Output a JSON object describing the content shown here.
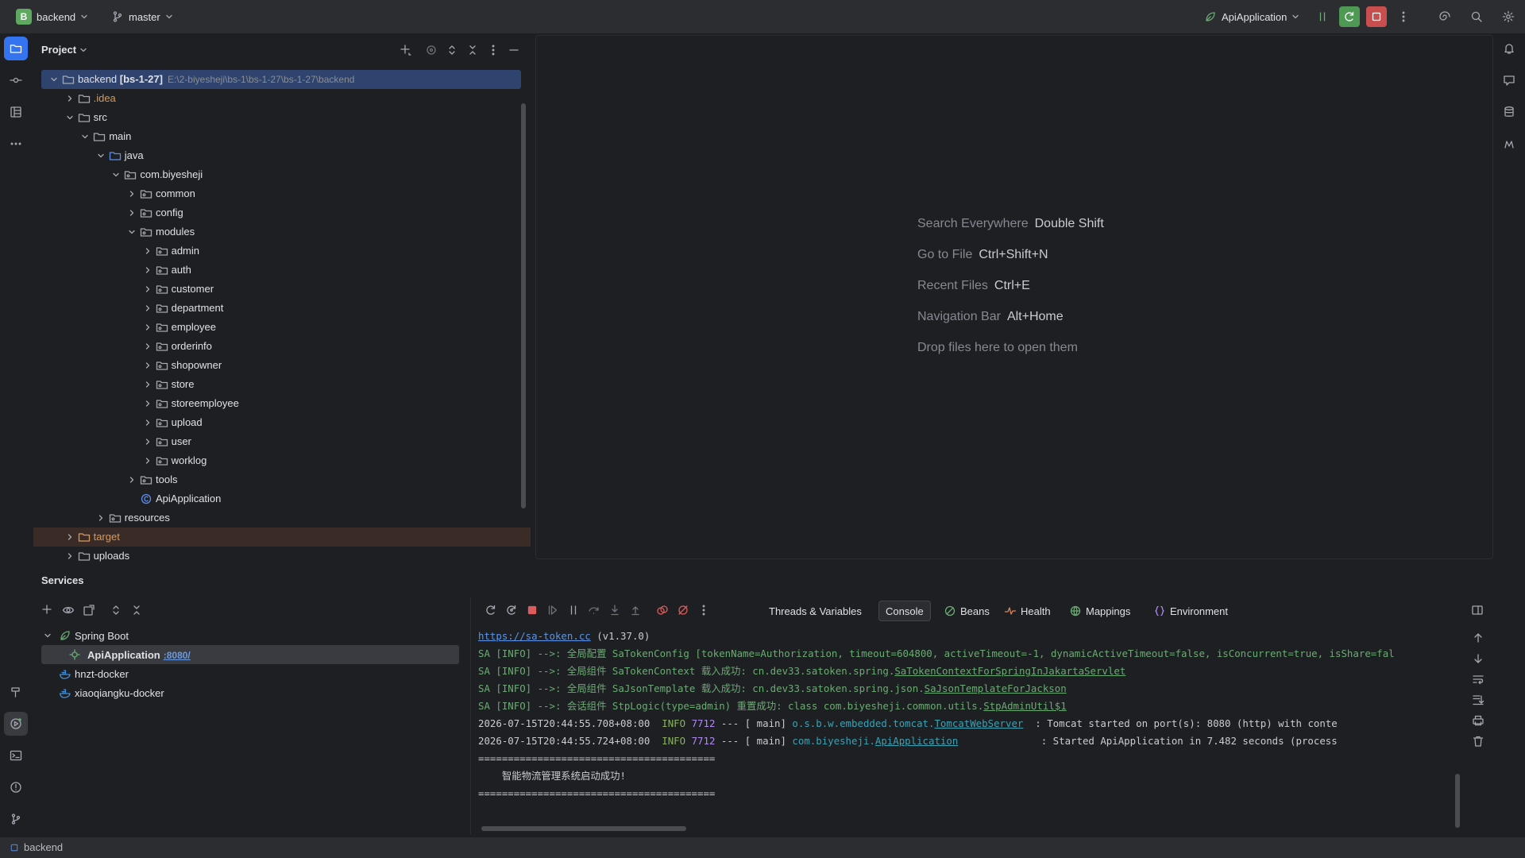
{
  "titlebar": {
    "project_badge": "B",
    "project_name": "backend",
    "branch": "master",
    "run_config": "ApiApplication"
  },
  "project_panel": {
    "title": "Project",
    "tree": [
      {
        "label": "backend",
        "suffix": "[bs-1-27]",
        "path": "E:\\2-biyesheji\\bs-1\\bs-1-27\\bs-1-27\\backend",
        "depth": 0,
        "expanded": true,
        "selected": true
      },
      {
        "label": ".idea",
        "depth": 1,
        "expanded": false,
        "style": "orange"
      },
      {
        "label": "src",
        "depth": 1,
        "expanded": true
      },
      {
        "label": "main",
        "depth": 2,
        "expanded": true
      },
      {
        "label": "java",
        "depth": 3,
        "expanded": true,
        "blue": true
      },
      {
        "label": "com.biyesheji",
        "depth": 4,
        "expanded": true,
        "pkg": true
      },
      {
        "label": "common",
        "depth": 5,
        "expanded": false,
        "pkg": true
      },
      {
        "label": "config",
        "depth": 5,
        "expanded": false,
        "pkg": true
      },
      {
        "label": "modules",
        "depth": 5,
        "expanded": true,
        "pkg": true
      },
      {
        "label": "admin",
        "depth": 6,
        "expanded": false,
        "pkg": true
      },
      {
        "label": "auth",
        "depth": 6,
        "expanded": false,
        "pkg": true
      },
      {
        "label": "customer",
        "depth": 6,
        "expanded": false,
        "pkg": true
      },
      {
        "label": "department",
        "depth": 6,
        "expanded": false,
        "pkg": true
      },
      {
        "label": "employee",
        "depth": 6,
        "expanded": false,
        "pkg": true
      },
      {
        "label": "orderinfo",
        "depth": 6,
        "expanded": false,
        "pkg": true
      },
      {
        "label": "shopowner",
        "depth": 6,
        "expanded": false,
        "pkg": true
      },
      {
        "label": "store",
        "depth": 6,
        "expanded": false,
        "pkg": true
      },
      {
        "label": "storeemployee",
        "depth": 6,
        "expanded": false,
        "pkg": true
      },
      {
        "label": "upload",
        "depth": 6,
        "expanded": false,
        "pkg": true
      },
      {
        "label": "user",
        "depth": 6,
        "expanded": false,
        "pkg": true
      },
      {
        "label": "worklog",
        "depth": 6,
        "expanded": false,
        "pkg": true
      },
      {
        "label": "tools",
        "depth": 5,
        "expanded": false,
        "pkg": true
      },
      {
        "label": "ApiApplication",
        "depth": 5,
        "leaf": true,
        "spring": true
      },
      {
        "label": "resources",
        "depth": 3,
        "expanded": false,
        "res": true
      },
      {
        "label": "target",
        "depth": 1,
        "expanded": false,
        "excluded": true
      },
      {
        "label": "uploads",
        "depth": 1,
        "expanded": false
      }
    ]
  },
  "editor": {
    "hints": [
      {
        "label": "Search Everywhere",
        "key": "Double Shift"
      },
      {
        "label": "Go to File",
        "key": "Ctrl+Shift+N"
      },
      {
        "label": "Recent Files",
        "key": "Ctrl+E"
      },
      {
        "label": "Navigation Bar",
        "key": "Alt+Home"
      },
      {
        "label": "Drop files here to open them",
        "key": ""
      }
    ]
  },
  "services": {
    "title": "Services",
    "tree": {
      "group": "Spring Boot",
      "app": "ApiApplication",
      "app_port": ":8080/",
      "docker1": "hnzt-docker",
      "docker2": "xiaoqiangku-docker"
    },
    "tabs": [
      "Threads & Variables",
      "Console",
      "Beans",
      "Health",
      "Mappings",
      "Environment"
    ],
    "active_tab": "Console",
    "console": {
      "l1_link": "https://sa-token.cc",
      "l1_rest": " (v1.37.0)",
      "l2": "SA [INFO] -->: 全局配置 SaTokenConfig [tokenName=Authorization, timeout=604800, activeTimeout=-1, dynamicActiveTimeout=false, isConcurrent=true, isShare=fal",
      "l3_pre": "SA [INFO] -->: 全局组件 SaTokenContext 载入成功: cn.dev33.satoken.spring.",
      "l3_u": "SaTokenContextForSpringInJakartaServlet",
      "l4_pre": "SA [INFO] -->: 全局组件 SaJsonTemplate 载入成功: cn.dev33.satoken.spring.json.",
      "l4_u": "SaJsonTemplateForJackson",
      "l5_pre": "SA [INFO] -->: 会话组件 StpLogic(type=admin) 重置成功: class com.biyesheji.common.utils.",
      "l5_u": "StpAdminUtil$1",
      "l6_ts": "2026-07-15T20:44:55.708+08:00",
      "l6_level": "INFO",
      "l6_pid": "7712",
      "l6_thread": "--- [           main]",
      "l6_cls_pre": "o.s.b.w.embedded.tomcat.",
      "l6_cls_u": "TomcatWebServer",
      "l6_msg": ": Tomcat started on port(s): 8080 (http) with conte",
      "l7_ts": "2026-07-15T20:44:55.724+08:00",
      "l7_level": "INFO",
      "l7_pid": "7712",
      "l7_thread": "--- [           main]",
      "l7_cls_pre": "com.biyesheji.",
      "l7_cls_u": "ApiApplication",
      "l7_msg": ": Started ApiApplication in 7.482 seconds (process",
      "sep": "========================================",
      "banner": "    智能物流管理系统启动成功!"
    }
  },
  "statusbar": {
    "crumb": "backend"
  }
}
